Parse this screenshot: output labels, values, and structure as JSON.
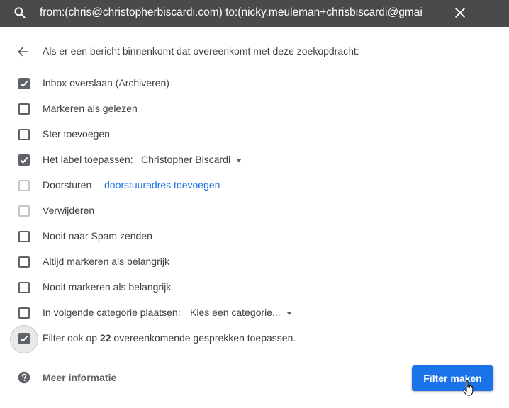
{
  "search": {
    "query": "from:(chris@christopherbiscardi.com) to:(nicky.meuleman+chrisbiscardi@gmai",
    "icon": "search-icon",
    "close_icon": "close-icon"
  },
  "dialog": {
    "heading": "Als er een bericht binnenkomt dat overeenkomt met deze zoekopdracht:",
    "options": [
      {
        "label": "Inbox overslaan (Archiveren)",
        "checked": true
      },
      {
        "label": "Markeren als gelezen",
        "checked": false
      },
      {
        "label": "Ster toevoegen",
        "checked": false
      },
      {
        "label": "Het label toepassen:",
        "checked": true,
        "dropdown_value": "Christopher Biscardi"
      },
      {
        "label": "Doorsturen",
        "checked": false,
        "disabled": true,
        "link": "doorstuuradres toevoegen"
      },
      {
        "label": "Verwijderen",
        "checked": false,
        "disabled": true
      },
      {
        "label": "Nooit naar Spam zenden",
        "checked": false
      },
      {
        "label": "Altijd markeren als belangrijk",
        "checked": false
      },
      {
        "label": "Nooit markeren als belangrijk",
        "checked": false
      },
      {
        "label": "In volgende categorie plaatsen:",
        "checked": false,
        "dropdown_value": "Kies een categorie..."
      },
      {
        "label_prefix": "Filter ook op",
        "count": "22",
        "label_suffix": "overeenkomende gesprekken toepassen.",
        "checked": true
      }
    ],
    "help_label": "Meer informatie",
    "create_button": "Filter maken"
  },
  "colors": {
    "search_bar_bg": "#4a4a4a",
    "accent": "#1a73e8",
    "checkbox": "#5f6368",
    "text": "#3c4043"
  }
}
